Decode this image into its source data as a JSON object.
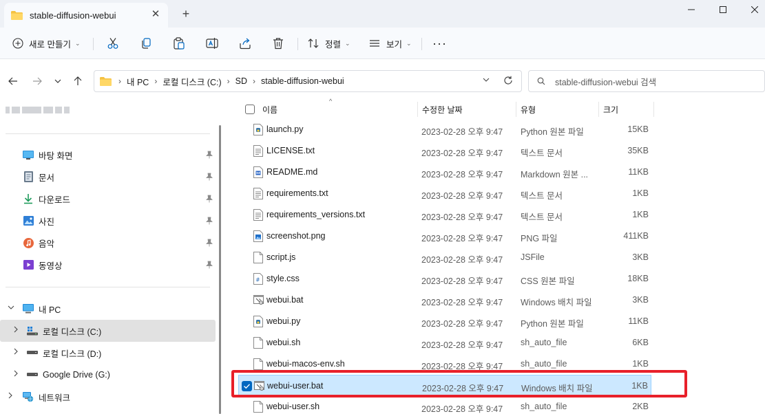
{
  "window": {
    "tab_title": "stable-diffusion-webui",
    "new_tab_symbol": "+",
    "close_tab_symbol": "✕"
  },
  "toolbar": {
    "new_label": "새로 만들기",
    "sort_label": "정렬",
    "view_label": "보기",
    "more_label": "···"
  },
  "address": {
    "crumbs": [
      "내 PC",
      "로컬 디스크 (C:)",
      "SD",
      "stable-diffusion-webui"
    ],
    "search_placeholder": "stable-diffusion-webui 검색"
  },
  "sidebar": {
    "quick_access": [
      {
        "label": "바탕 화면",
        "icon": "desktop-icon"
      },
      {
        "label": "문서",
        "icon": "documents-icon"
      },
      {
        "label": "다운로드",
        "icon": "download-icon"
      },
      {
        "label": "사진",
        "icon": "pictures-icon"
      },
      {
        "label": "음악",
        "icon": "music-icon"
      },
      {
        "label": "동영상",
        "icon": "videos-icon"
      }
    ],
    "this_pc": "내 PC",
    "drives": [
      "로컬 디스크 (C:)",
      "로컬 디스크 (D:)",
      "Google Drive (G:)"
    ],
    "network": "네트워크"
  },
  "columns": {
    "name": "이름",
    "date": "수정한 날짜",
    "type": "유형",
    "size": "크기"
  },
  "files": [
    {
      "name": "launch.py",
      "date": "2023-02-28 오후 9:47",
      "type": "Python 원본 파일",
      "size": "15KB",
      "icon": "python-file-icon"
    },
    {
      "name": "LICENSE.txt",
      "date": "2023-02-28 오후 9:47",
      "type": "텍스트 문서",
      "size": "35KB",
      "icon": "text-file-icon"
    },
    {
      "name": "README.md",
      "date": "2023-02-28 오후 9:47",
      "type": "Markdown 원본 ...",
      "size": "11KB",
      "icon": "markdown-file-icon"
    },
    {
      "name": "requirements.txt",
      "date": "2023-02-28 오후 9:47",
      "type": "텍스트 문서",
      "size": "1KB",
      "icon": "text-file-icon"
    },
    {
      "name": "requirements_versions.txt",
      "date": "2023-02-28 오후 9:47",
      "type": "텍스트 문서",
      "size": "1KB",
      "icon": "text-file-icon"
    },
    {
      "name": "screenshot.png",
      "date": "2023-02-28 오후 9:47",
      "type": "PNG 파일",
      "size": "411KB",
      "icon": "image-file-icon"
    },
    {
      "name": "script.js",
      "date": "2023-02-28 오후 9:47",
      "type": "JSFile",
      "size": "3KB",
      "icon": "blank-file-icon"
    },
    {
      "name": "style.css",
      "date": "2023-02-28 오후 9:47",
      "type": "CSS 원본 파일",
      "size": "18KB",
      "icon": "css-file-icon"
    },
    {
      "name": "webui.bat",
      "date": "2023-02-28 오후 9:47",
      "type": "Windows 배치 파일",
      "size": "3KB",
      "icon": "batch-file-icon"
    },
    {
      "name": "webui.py",
      "date": "2023-02-28 오후 9:47",
      "type": "Python 원본 파일",
      "size": "11KB",
      "icon": "python-file-icon"
    },
    {
      "name": "webui.sh",
      "date": "2023-02-28 오후 9:47",
      "type": "sh_auto_file",
      "size": "6KB",
      "icon": "blank-file-icon"
    },
    {
      "name": "webui-macos-env.sh",
      "date": "2023-02-28 오후 9:47",
      "type": "sh_auto_file",
      "size": "1KB",
      "icon": "blank-file-icon"
    },
    {
      "name": "webui-user.bat",
      "date": "2023-02-28 오후 9:47",
      "type": "Windows 배치 파일",
      "size": "1KB",
      "icon": "batch-file-icon",
      "selected": true
    },
    {
      "name": "webui-user.sh",
      "date": "2023-02-28 오후 9:47",
      "type": "sh_auto_file",
      "size": "2KB",
      "icon": "blank-file-icon"
    }
  ],
  "colors": {
    "selection_bg": "#cce8ff",
    "selection_border": "#99d1ff",
    "highlight_box": "#e8202a",
    "folder_yellow": "#f5c242",
    "accent_blue": "#0067c0"
  }
}
